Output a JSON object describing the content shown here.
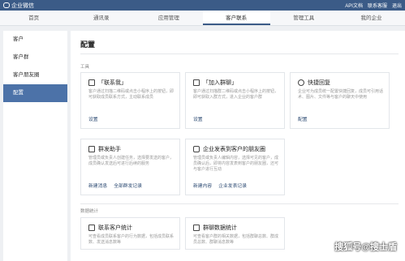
{
  "topbar": {
    "brand": "企业微信",
    "links": [
      "API文档",
      "联系客服",
      "退出"
    ]
  },
  "nav": {
    "tabs": [
      "首页",
      "通讯录",
      "应用管理",
      "客户联系",
      "管理工具",
      "我的企业"
    ],
    "active": 3
  },
  "sidebar": {
    "items": [
      {
        "label": "客户"
      },
      {
        "label": "客户群"
      },
      {
        "label": "客户朋友圈"
      },
      {
        "label": "配置",
        "active": true
      }
    ]
  },
  "main": {
    "title": "配置",
    "section_tools": "工具",
    "section_stats": "数据统计",
    "cards": [
      {
        "title": "「联系我」",
        "icon": "contact-me-icon",
        "desc": "客户通过扫描二维码或点击小程序上的按钮，即可获取成员联系方式，主动联系成员",
        "links": [
          "设置"
        ]
      },
      {
        "title": "「加入群聊」",
        "icon": "qr-code-icon",
        "desc": "客户通过扫描群二维码或点击小程序上的按钮，即可获取入群方式，进入企业的客户群",
        "links": [
          "设置"
        ]
      },
      {
        "title": "快捷回复",
        "icon": "quick-reply-icon",
        "desc": "企业可为成员统一配置快捷回复，成员可引用话术、图片、文件等与客户的聊天中使用",
        "links": [
          "配置"
        ]
      },
      {
        "title": "群发助手",
        "icon": "broadcast-icon",
        "desc": "管理员或负责人创建任务，选择要发送的客户，成员确认发送后可进行后续的服务",
        "links": [
          "新建消息",
          "全部群发记录"
        ]
      },
      {
        "title": "企业发表到客户的朋友圈",
        "icon": "camera-icon",
        "desc": "管理员或负责人编辑内容，选择可见的客户，成员确认后，即将内容发表到客户的朋友圈，还可与客户进行互动",
        "links": [
          "新建内容",
          "企业发表记录"
        ]
      },
      {
        "title": "联系客户统计",
        "icon": "stats-icon",
        "desc": "可查看成员联系客户的行为数据，包括成员联系数、发送消息数等"
      },
      {
        "title": "群聊数据统计",
        "icon": "group-stats-icon",
        "desc": "可查看客户群的相关数据，包括群聊总数、群成员总数、群聊消息数等"
      }
    ]
  },
  "watermark": "搜狐号@搜士盾"
}
